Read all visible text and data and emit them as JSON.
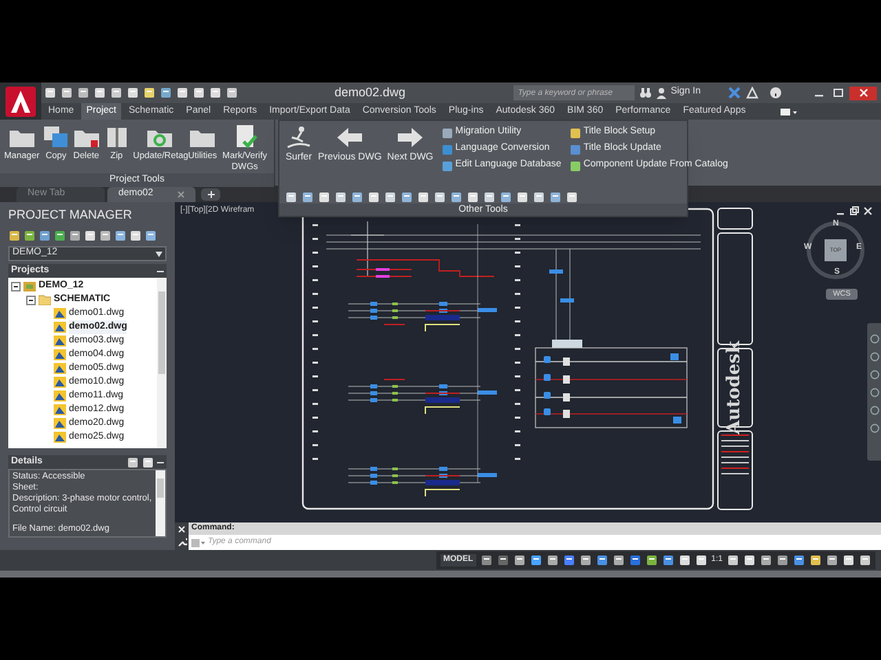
{
  "title_bar": {
    "title": "demo02.dwg",
    "search": {
      "placeholder": "Type a keyword or phrase"
    },
    "sign_in": "Sign In"
  },
  "ribbon_tabs": [
    {
      "label": "Home",
      "selected": false
    },
    {
      "label": "Project",
      "selected": true
    },
    {
      "label": "Schematic",
      "selected": false
    },
    {
      "label": "Panel",
      "selected": false
    },
    {
      "label": "Reports",
      "selected": false
    },
    {
      "label": "Import/Export Data",
      "selected": false
    },
    {
      "label": "Conversion Tools",
      "selected": false
    },
    {
      "label": "Plug-ins",
      "selected": false
    },
    {
      "label": "Autodesk 360",
      "selected": false
    },
    {
      "label": "BIM 360",
      "selected": false
    },
    {
      "label": "Performance",
      "selected": false
    },
    {
      "label": "Featured Apps",
      "selected": false
    }
  ],
  "project_tools": {
    "title": "Project Tools",
    "buttons": [
      {
        "label": "Manager",
        "kind": "folder"
      },
      {
        "label": "Copy",
        "kind": "copy"
      },
      {
        "label": "Delete",
        "kind": "delete"
      },
      {
        "label": "Zip",
        "kind": "zip"
      },
      {
        "label": "Update/Retag",
        "kind": "refresh"
      },
      {
        "label": "Utilities",
        "kind": "folder"
      },
      {
        "label": "Mark/Verify DWGs",
        "kind": "check"
      }
    ]
  },
  "other_tools": {
    "title": "Other Tools",
    "large_buttons": [
      {
        "label": "Surfer",
        "kind": "surfer"
      },
      {
        "label": "Previous DWG",
        "kind": "left"
      },
      {
        "label": "Next DWG",
        "kind": "right"
      }
    ],
    "small_buttons": [
      {
        "label": "Migration Utility"
      },
      {
        "label": "Language Conversion"
      },
      {
        "label": "Edit Language Database"
      },
      {
        "label": "Title Block Setup"
      },
      {
        "label": "Title Block Update"
      },
      {
        "label": "Component Update From Catalog"
      }
    ]
  },
  "file_tabs": [
    {
      "label": "New Tab",
      "selected": false
    },
    {
      "label": "demo02",
      "selected": true
    }
  ],
  "project_manager": {
    "title": "PROJECT MANAGER",
    "project_select": "DEMO_12",
    "projects_header": "Projects",
    "tree": [
      {
        "label": "DEMO_12",
        "kind": "project",
        "expanded": true,
        "children": [
          {
            "label": "SCHEMATIC",
            "kind": "folder",
            "expanded": true,
            "children": [
              {
                "label": "demo01.dwg",
                "kind": "file",
                "selected": false
              },
              {
                "label": "demo02.dwg",
                "kind": "file",
                "selected": true
              },
              {
                "label": "demo03.dwg",
                "kind": "file",
                "selected": false
              },
              {
                "label": "demo04.dwg",
                "kind": "file",
                "selected": false
              },
              {
                "label": "demo05.dwg",
                "kind": "file",
                "selected": false
              },
              {
                "label": "demo10.dwg",
                "kind": "file",
                "selected": false
              },
              {
                "label": "demo11.dwg",
                "kind": "file",
                "selected": false
              },
              {
                "label": "demo12.dwg",
                "kind": "file",
                "selected": false
              },
              {
                "label": "demo20.dwg",
                "kind": "file",
                "selected": false
              },
              {
                "label": "demo25.dwg",
                "kind": "file",
                "selected": false
              }
            ]
          }
        ]
      }
    ],
    "details_header": "Details",
    "details": [
      [
        "Status: Accessible",
        "Sheet:",
        "Description: 3-phase motor control, Control circuit"
      ],
      [
        "File Name: demo02.dwg"
      ]
    ]
  },
  "viewport": {
    "label": "[-][Top][2D Wirefram",
    "compass": {
      "north": "N",
      "south": "S",
      "east": "E",
      "west": "W",
      "cube": "TOP",
      "ucs": "WCS"
    },
    "title_block": "Autodesk"
  },
  "command_line": {
    "label": "Command:",
    "placeholder": "Type a command"
  },
  "status_bar": {
    "model": "MODEL",
    "scale": "1:1"
  }
}
